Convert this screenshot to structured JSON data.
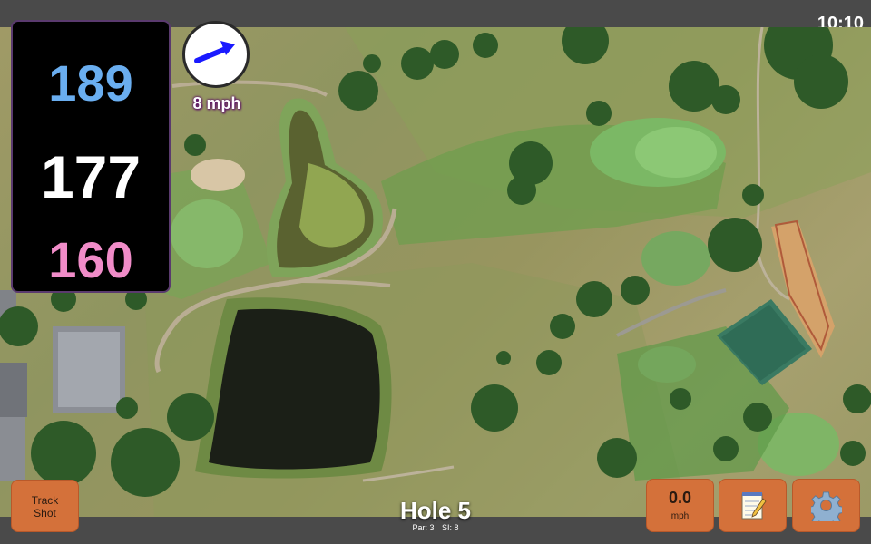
{
  "status": {
    "clock": "10:10"
  },
  "distances": {
    "back": "189",
    "middle": "177",
    "front": "160"
  },
  "wind": {
    "speed_label": "8 mph",
    "direction_icon": "wind-arrow-icon"
  },
  "hole": {
    "title": "Hole 5",
    "par": "Par: 3",
    "si": "SI: 8"
  },
  "buttons": {
    "track_shot_line1": "Track",
    "track_shot_line2": "Shot",
    "wind_value": "0.0",
    "wind_unit": "mph",
    "notes_icon": "notepad-icon",
    "settings_icon": "gear-icon"
  },
  "colors": {
    "back_distance": "#6aaef0",
    "middle_distance": "#ffffff",
    "front_distance": "#f08cc8",
    "button": "#d4713a",
    "bar": "#4a4a4a",
    "wind_arrow": "#1a1aff"
  }
}
